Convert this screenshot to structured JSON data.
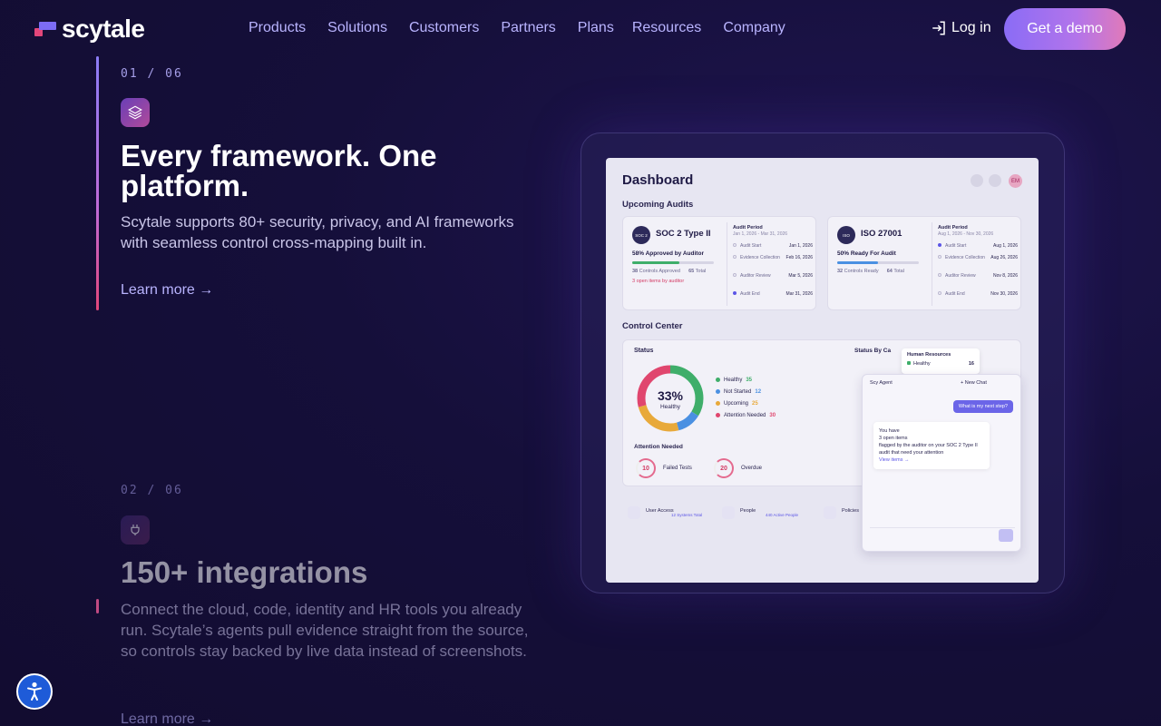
{
  "brand": {
    "name": "scytale"
  },
  "nav": {
    "menu": [
      "Products",
      "Solutions",
      "Customers",
      "Partners",
      "Plans",
      "Resources",
      "Company"
    ],
    "login": "Log in",
    "cta": "Get a demo"
  },
  "features": [
    {
      "step": "01 / 06",
      "icon": "layers-icon",
      "title_line1": "Every framework. One",
      "title_line2": "platform.",
      "description": "Scytale supports 80+ security, privacy, and AI frameworks with seamless control cross-mapping built in.",
      "link": "Learn more →"
    },
    {
      "step": "02 / 06",
      "icon": "plug-icon",
      "title": "150+ integrations",
      "description": "Connect the cloud, code, identity and HR tools you already run. Scytale’s agents pull evidence straight from the source, so controls stay backed by live data instead of screenshots.",
      "link": "Learn more →"
    }
  ],
  "dashboard": {
    "title": "Dashboard",
    "avatar": "EM",
    "upcoming_label": "Upcoming Audits",
    "audits": [
      {
        "badge": "SOC 2",
        "name": "SOC 2 Type II",
        "ready": "58% Approved by Auditor",
        "progress": 0.58,
        "controls_approved": "38",
        "controls_label": "Controls Approved",
        "controls_total": "65",
        "total_label": "Total",
        "open_items": "3 open items by auditor",
        "period_label": "Audit Period",
        "period": "Jan 1, 2026 - Mar 31, 2026",
        "timeline": [
          {
            "label": "Audit Start",
            "date": "Jan 1, 2026"
          },
          {
            "label": "Evidence Collection",
            "date": "Feb 16, 2026"
          },
          {
            "label": "Auditor Review",
            "date": "Mar 5, 2026"
          },
          {
            "label": "Audit End",
            "date": "Mar 31, 2026"
          }
        ]
      },
      {
        "badge": "ISO",
        "name": "ISO 27001",
        "ready": "50% Ready For Audit",
        "progress": 0.5,
        "controls_approved": "32",
        "controls_label": "Controls Ready",
        "controls_total": "64",
        "total_label": "Total",
        "period_label": "Audit Period",
        "period": "Aug 1, 2026 - Nov 30, 2026",
        "timeline": [
          {
            "label": "Audit Start",
            "date": "Aug 1, 2026"
          },
          {
            "label": "Evidence Collection",
            "date": "Aug 26, 2026"
          },
          {
            "label": "Auditor Review",
            "date": "Nov 8, 2026"
          },
          {
            "label": "Audit End",
            "date": "Nov 30, 2026"
          }
        ]
      }
    ],
    "control_center": {
      "label": "Control Center",
      "status_label": "Status",
      "percent": "33%",
      "percent_label": "Healthy",
      "legend": [
        {
          "label": "Healthy",
          "count": "35",
          "color": "#3fae6a"
        },
        {
          "label": "Not Started",
          "count": "12",
          "color": "#4a90e2"
        },
        {
          "label": "Upcoming",
          "count": "25",
          "color": "#e8a93a"
        },
        {
          "label": "Attention Needed",
          "count": "30",
          "color": "#e0466e"
        }
      ],
      "attention_label": "Attention Needed",
      "failed_tests": "10",
      "failed_label": "Failed Tests",
      "overdue": "20",
      "overdue_label": "Overdue",
      "status_by_cat": "Status By Ca"
    },
    "hr_popup": {
      "title": "Human Resources",
      "status": "Healthy",
      "count": "16"
    },
    "agent": {
      "title": "Scy Agent",
      "new_chat": "+ New Chat",
      "question": "What is my next step?",
      "answer_1": "You have",
      "answer_2": "3 open items",
      "answer_3": "flagged by the auditor on your SOC 2 Type II audit that need your attention",
      "link": "View items →"
    },
    "bottom": [
      {
        "title": "User Access",
        "link": "12 Systems Total"
      },
      {
        "title": "People",
        "link": "440 Active People"
      },
      {
        "title": "Policies"
      }
    ]
  }
}
